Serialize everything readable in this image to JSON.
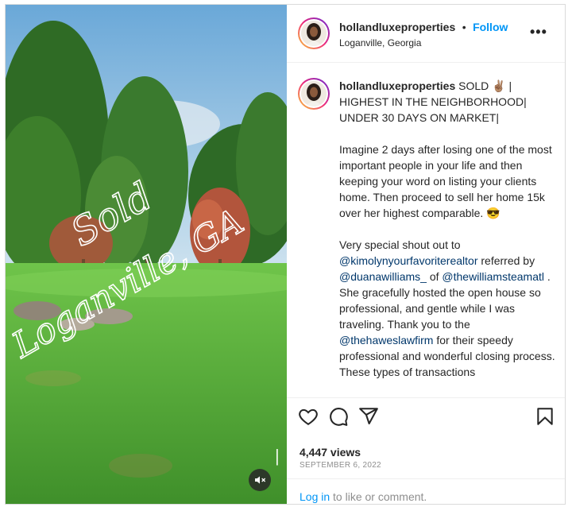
{
  "post": {
    "username": "hollandluxeproperties",
    "separator": "•",
    "follow_label": "Follow",
    "location": "Loganville, Georgia",
    "more_label": "•••",
    "media_overlay_text_1": "Sold",
    "media_overlay_text_2": "Loganville, GA",
    "caption": {
      "username": "hollandluxeproperties",
      "headline_1": " SOLD ✌🏽 | HIGHEST IN THE NEIGHBORHOOD| UNDER 30 DAYS ON MARKET|",
      "paragraph_2": "Imagine 2 days after losing one of the most important people in your life and then keeping your word on listing your clients home. Then proceed to sell her home 15k over her highest comparable. 😎",
      "p3_text_a": "Very special shout out to ",
      "p3_mention_1": "@kimolynyourfavoriterealtor",
      "p3_text_b": " referred by ",
      "p3_mention_2": "@duanawilliams_",
      "p3_text_c": " of ",
      "p3_mention_3": "@thewilliamsteamatl",
      "p3_text_d": " . She gracefully hosted the open house so professional, and gentle while I was traveling. Thank you to the ",
      "p3_mention_4": "@thehaweslawfirm",
      "p3_text_e": " for their speedy professional and wonderful closing process. These types of transactions"
    },
    "views": "4,447 views",
    "date": "SEPTEMBER 6, 2022",
    "login_link": "Log in",
    "login_text": " to like or comment."
  },
  "icons": {
    "like": "heart-icon",
    "comment": "comment-icon",
    "share": "share-icon",
    "save": "bookmark-icon",
    "mute": "muted-speaker-icon"
  },
  "colors": {
    "follow_blue": "#0095f6",
    "mention_blue": "#00376b",
    "muted_gray": "#8e8e8e"
  }
}
